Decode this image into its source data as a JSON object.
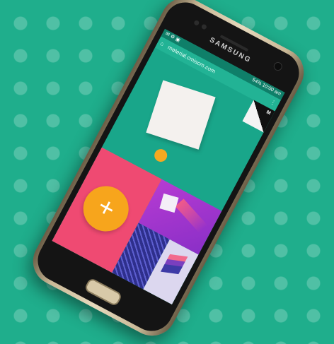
{
  "phone": {
    "brand": "SAMSUNG",
    "status": {
      "left_icons": "✉ ⚙ ▣",
      "battery": "54%",
      "time": "10:00 am"
    },
    "browser": {
      "url": "material.cmiscm.com",
      "home_glyph": "⌂",
      "menu_glyph": "⋮"
    },
    "corner_letter": "M",
    "fab_glyph": "+"
  },
  "colors": {
    "background": "#1fae8c",
    "screen_teal": "#19a68a",
    "pink": "#ef4a72",
    "orange": "#f7a51c",
    "purple": "#b63bd2",
    "navy": "#2e2f8c",
    "lilac": "#dcd7ef"
  }
}
